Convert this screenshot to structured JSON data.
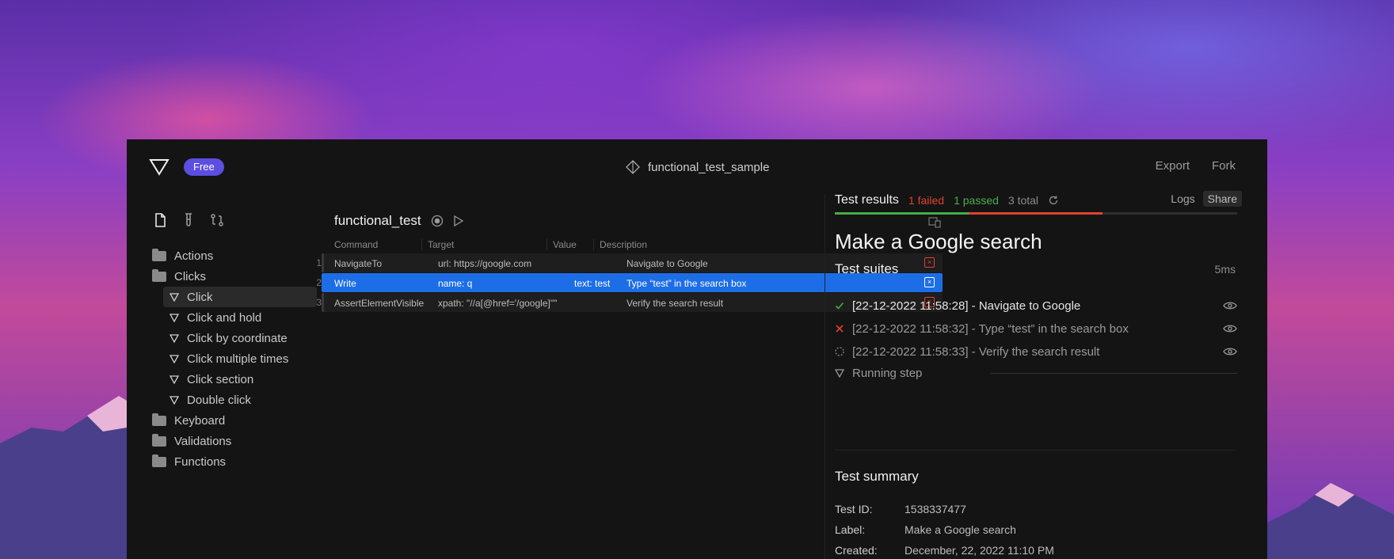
{
  "topbar": {
    "plan_badge": "Free",
    "project_name": "functional_test_sample",
    "export_label": "Export",
    "fork_label": "Fork"
  },
  "sidebar": {
    "icons": [
      "file-icon",
      "test-tube-icon",
      "flow-icon"
    ],
    "tree": [
      {
        "type": "folder",
        "label": "Actions"
      },
      {
        "type": "folder",
        "label": "Clicks"
      },
      {
        "type": "item",
        "label": "Click",
        "selected": true
      },
      {
        "type": "item",
        "label": "Click and hold"
      },
      {
        "type": "item",
        "label": "Click by coordinate"
      },
      {
        "type": "item",
        "label": "Click multiple times"
      },
      {
        "type": "item",
        "label": "Click section"
      },
      {
        "type": "item",
        "label": "Double click"
      },
      {
        "type": "folder",
        "label": "Keyboard"
      },
      {
        "type": "folder",
        "label": "Validations"
      },
      {
        "type": "folder",
        "label": "Functions"
      }
    ]
  },
  "editor": {
    "title": "functional_test",
    "columns": {
      "command": "Command",
      "target": "Target",
      "value": "Value",
      "description": "Description"
    },
    "rows": [
      {
        "num": "1",
        "command": "NavigateTo",
        "target": "url: https://google.com",
        "value": "",
        "description": "Navigate to Google"
      },
      {
        "num": "2",
        "command": "Write",
        "target": "name: q",
        "value": "text: test",
        "description": "Type “test” in the search box",
        "active": true
      },
      {
        "num": "3",
        "command": "AssertElementVisible",
        "target": "xpath: \"//a[@href='/google]\"\"",
        "value": "",
        "description": "Verify the search result"
      }
    ],
    "delete_glyph": "×"
  },
  "results": {
    "title": "Test results",
    "failed": "1 failed",
    "passed": "1 passed",
    "total": "3 total",
    "logs_label": "Logs",
    "share_label": "Share",
    "progress": {
      "passed_fraction": 0.333,
      "failed_fraction": 0.333
    },
    "colors": {
      "passed": "#44ad44",
      "failed": "#e0432d",
      "accent": "#1d6ee6",
      "badge": "#5b4ee0"
    },
    "heading": "Make a Google search",
    "suites_title": "Test suites",
    "duration": "5ms",
    "steps": [
      {
        "status": "passed",
        "icon": "check-icon",
        "text": "[22-12-2022 11:58:28] - Navigate to Google"
      },
      {
        "status": "failed",
        "icon": "cross-icon",
        "text": "[22-12-2022 11:58:32] - Type “test” in the search box"
      },
      {
        "status": "pending",
        "icon": "spinner-icon",
        "text": "[22-12-2022 11:58:33] - Verify the search result"
      }
    ],
    "running_step": "Running step",
    "summary": {
      "title": "Test summary",
      "fields": [
        {
          "key": "Test ID:",
          "value": "1538337477"
        },
        {
          "key": "Label:",
          "value": "Make a Google search"
        },
        {
          "key": "Created:",
          "value": "December, 22, 2022 11:10 PM"
        }
      ]
    }
  }
}
